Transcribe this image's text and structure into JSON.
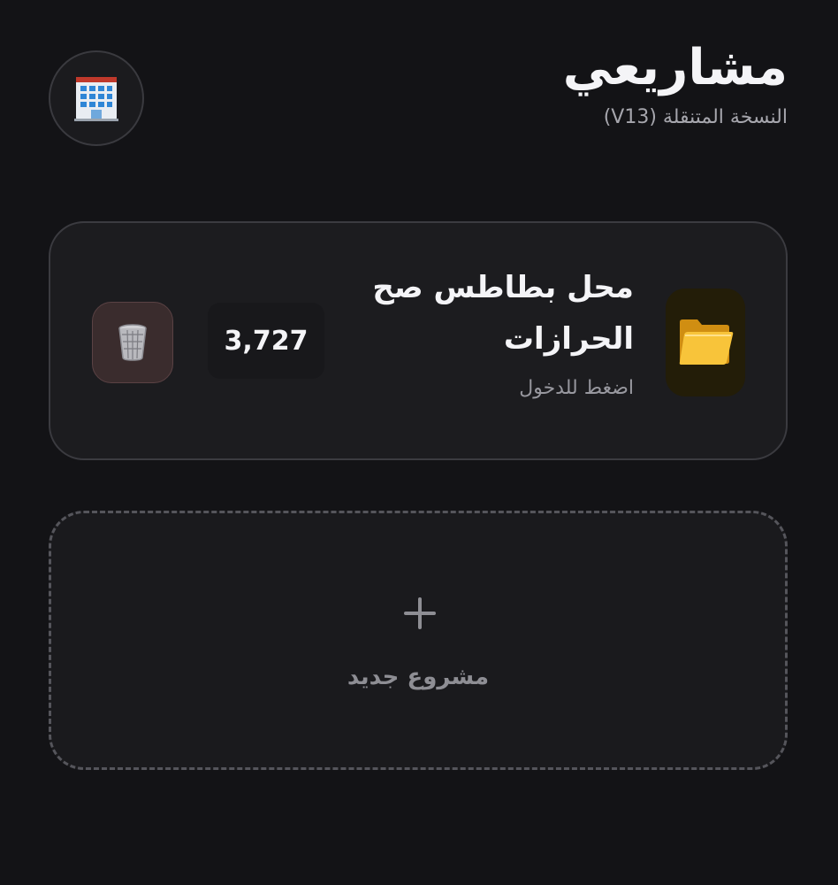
{
  "header": {
    "title": "مشاريعي",
    "subtitle": "النسخة المتنقلة (V13)",
    "building_icon": "building-icon"
  },
  "projects": [
    {
      "name": "محل بطاطس صح الحرازات",
      "hint": "اضغط للدخول",
      "count": "3,727",
      "icon": "folder-icon",
      "delete_icon": "trash-icon"
    }
  ],
  "new_project": {
    "label": "مشروع جديد",
    "icon": "plus-icon"
  },
  "colors": {
    "background": "#131316",
    "card": "#1c1c1f",
    "folder": "#f5b82e",
    "trash_bg": "#3a2c2d"
  }
}
